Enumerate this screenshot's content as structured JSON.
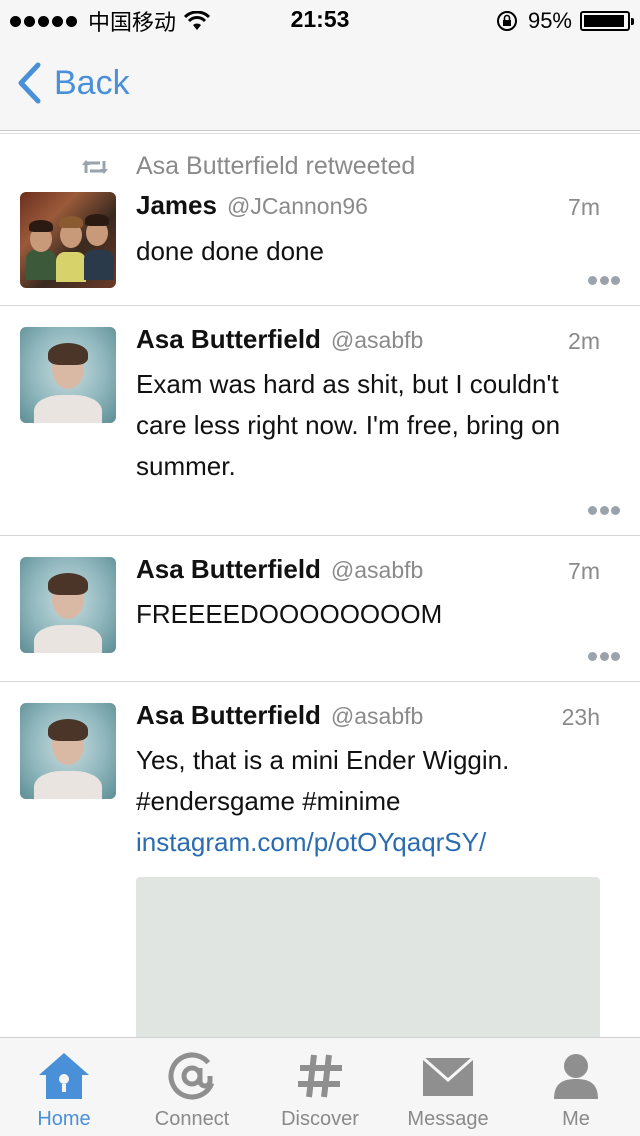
{
  "status_bar": {
    "carrier": "中国移动",
    "time": "21:53",
    "battery": "95%",
    "battery_level": 0.95
  },
  "nav": {
    "back_label": "Back"
  },
  "tweets": [
    {
      "retweeted_by": "Asa Butterfield retweeted",
      "name": "James",
      "handle": "@JCannon96",
      "time": "7m",
      "text": "done done done"
    },
    {
      "name": "Asa Butterfield",
      "handle": "@asabfb",
      "time": "2m",
      "text": "Exam was hard as shit, but I couldn't care less right now. I'm free, bring on summer."
    },
    {
      "name": "Asa Butterfield",
      "handle": "@asabfb",
      "time": "7m",
      "text": "FREEEEDOOOOOOOOM"
    },
    {
      "name": "Asa Butterfield",
      "handle": "@asabfb",
      "time": "23h",
      "text": "Yes, that is a mini Ender Wiggin. #endersgame #minime",
      "link": "instagram.com/p/otOYqaqrSY/"
    }
  ],
  "tabs": [
    {
      "label": "Home",
      "icon": "home-icon"
    },
    {
      "label": "Connect",
      "icon": "at-icon"
    },
    {
      "label": "Discover",
      "icon": "hashtag-icon"
    },
    {
      "label": "Message",
      "icon": "envelope-icon"
    },
    {
      "label": "Me",
      "icon": "person-icon"
    }
  ],
  "colors": {
    "accent": "#4a90d9",
    "link": "#2b6cb0",
    "muted": "#8a8a8a"
  }
}
